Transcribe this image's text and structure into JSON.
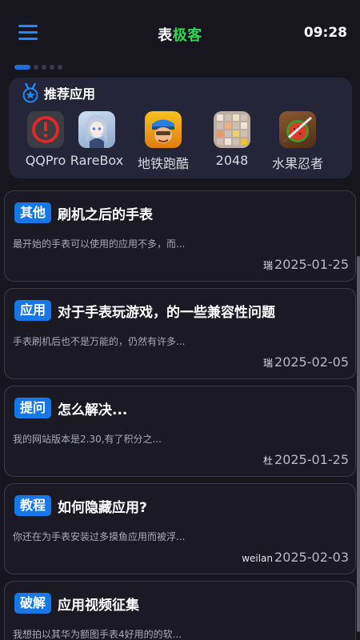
{
  "header": {
    "title_part1": "表",
    "title_part2": "极客",
    "time": "09:28"
  },
  "recommend": {
    "title": "推荐应用",
    "apps": [
      {
        "label": "QQPro",
        "icon": "qqpro-app-icon"
      },
      {
        "label": "RareBox",
        "icon": "rarebox-app-icon"
      },
      {
        "label": "地铁跑酷",
        "icon": "subway-surfers-app-icon"
      },
      {
        "label": "2048",
        "icon": "2048-app-icon"
      },
      {
        "label": "水果忍者",
        "icon": "fruit-ninja-app-icon"
      }
    ]
  },
  "posts": [
    {
      "tag": "其他",
      "title": "刷机之后的手表",
      "excerpt": "最开始的手表可以使用的应用不多，而...",
      "author": "瑞",
      "date": "2025-01-25"
    },
    {
      "tag": "应用",
      "title": "对于手表玩游戏，的一些兼容性问题",
      "excerpt": "手表刷机后也不是万能的，仍然有许多...",
      "author": "瑞",
      "date": "2025-02-05"
    },
    {
      "tag": "提问",
      "title": "怎么解决...",
      "excerpt": "我的网站版本是2.30,有了积分之...",
      "author": "杜",
      "date": "2025-01-25"
    },
    {
      "tag": "教程",
      "title": "如何隐藏应用?",
      "excerpt": "你还在为手表安装过多摸鱼应用而被浮...",
      "author": "weilan",
      "date": "2025-02-03"
    },
    {
      "tag": "破解",
      "title": "应用视频征集",
      "excerpt": "我想拍以其华为额图手表4好用的的软...",
      "author": "",
      "date": ""
    }
  ],
  "colors": {
    "accent": "#1678e8",
    "brand_green": "#33d651",
    "background": "#17161f"
  }
}
